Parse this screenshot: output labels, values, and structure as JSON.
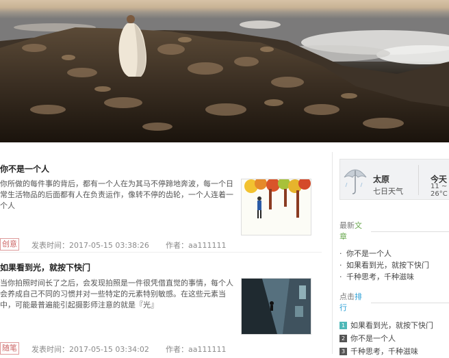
{
  "articles": [
    {
      "title": "你不是一个人",
      "excerpt": "你所做的每件事的背后，都有一个人在为其马不停蹄地奔波，每一个日常生活物品的后面都有人在负责运作，像转不停的齿轮，一个人连着一个人",
      "category": "创意",
      "time_label": "发表时间：2017-05-15 03:38:26",
      "author_label": "作者：aa111111"
    },
    {
      "title": "如果看到光，就按下快门",
      "excerpt": "当你拍照时间长了之后，会发现拍照是一件很凭借直觉的事情，每个人会养成自己不同的习惯并对一些特定的元素特别敏感。在这些元素当中，可能最普遍能引起摄影师注意的就是『光』",
      "category": "随笔",
      "time_label": "发表时间：2017-05-15 03:34:02",
      "author_label": "作者：aa111111"
    }
  ],
  "sidebar": {
    "weather": {
      "city": "太原",
      "forecast": "七日天气",
      "today": "今天",
      "temp_line1": "11 ~",
      "temp_line2": "26°C"
    },
    "latest": {
      "title_plain": "最新",
      "title_hl": "文",
      "title_rest": "章",
      "items": [
        "你不是一个人",
        "如果看到光，就按下快门",
        "千种思考，千种滋味"
      ]
    },
    "ranking": {
      "title_plain": "点击",
      "title_hl": "排",
      "title_rest": "行",
      "items": [
        {
          "rank": "1",
          "label": "如果看到光，就按下快门"
        },
        {
          "rank": "2",
          "label": "你不是一个人"
        },
        {
          "rank": "3",
          "label": "千种思考，千种滋味"
        }
      ]
    }
  },
  "colors": {
    "accent_green": "#6aa84f",
    "accent_blue": "#2a9fd6",
    "category_red": "#cc6666",
    "rank_first": "#4fb8b8"
  }
}
